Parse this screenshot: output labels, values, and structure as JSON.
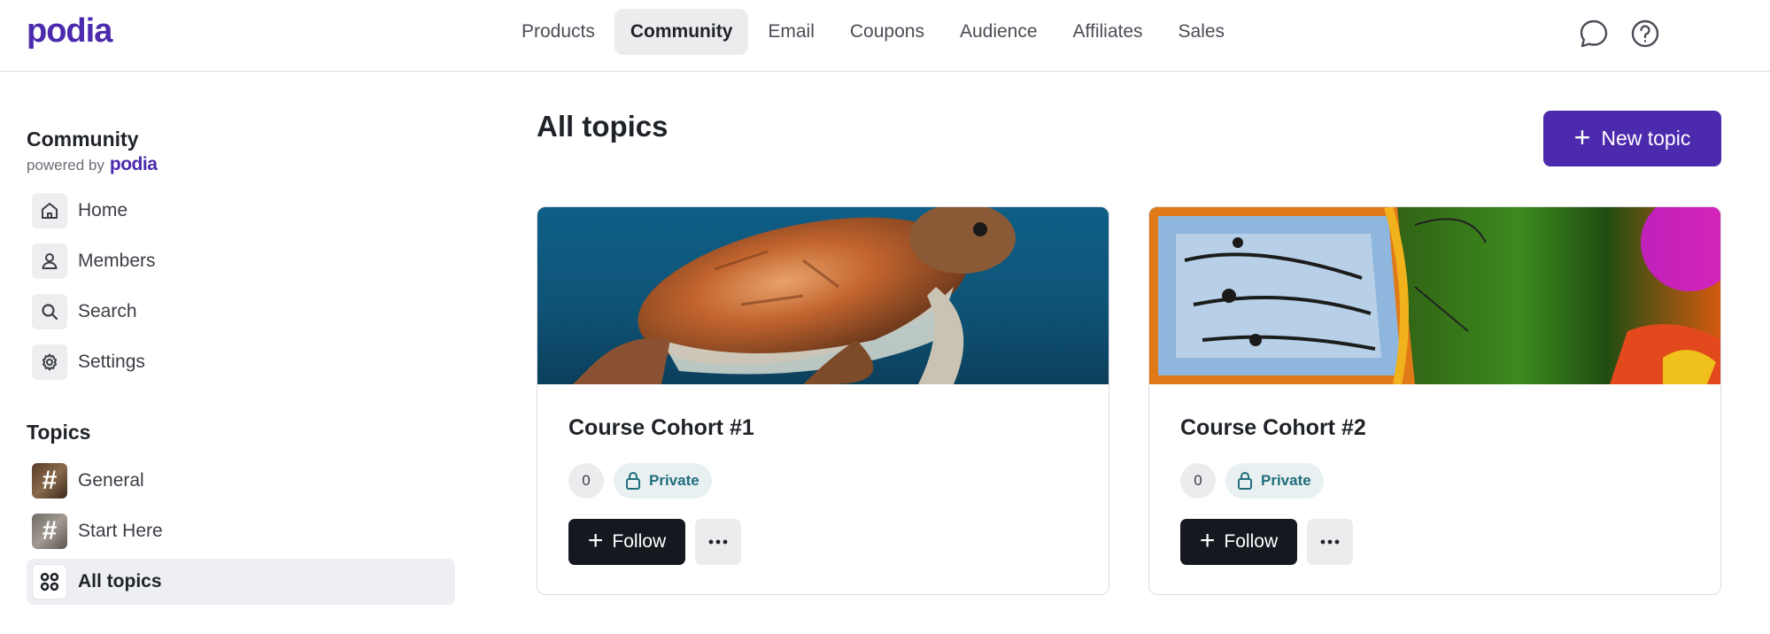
{
  "app": {
    "logo": "podia"
  },
  "nav": {
    "items": [
      {
        "label": "Products",
        "active": false
      },
      {
        "label": "Community",
        "active": true
      },
      {
        "label": "Email",
        "active": false
      },
      {
        "label": "Coupons",
        "active": false
      },
      {
        "label": "Audience",
        "active": false
      },
      {
        "label": "Affiliates",
        "active": false
      },
      {
        "label": "Sales",
        "active": false
      }
    ],
    "icons": [
      "chat-bubble-icon",
      "help-circle-icon"
    ]
  },
  "sidebar": {
    "title": "Community",
    "powered_by": "powered by",
    "powered_logo": "podia",
    "items": [
      {
        "label": "Home",
        "icon": "home-icon"
      },
      {
        "label": "Members",
        "icon": "user-icon"
      },
      {
        "label": "Search",
        "icon": "search-icon"
      },
      {
        "label": "Settings",
        "icon": "gear-icon"
      }
    ],
    "topics_title": "Topics",
    "topics": [
      {
        "label": "General",
        "icon": "hash-icon"
      },
      {
        "label": "Start Here",
        "icon": "hash-icon"
      },
      {
        "label": "All topics",
        "icon": "grid-icon",
        "active": true
      }
    ]
  },
  "main": {
    "title": "All topics",
    "new_topic_label": "New topic",
    "cards": [
      {
        "title": "Course Cohort #1",
        "count": "0",
        "privacy": "Private",
        "follow_label": "Follow",
        "image": "sea-turtle"
      },
      {
        "title": "Course Cohort #2",
        "count": "0",
        "privacy": "Private",
        "follow_label": "Follow",
        "image": "butterfly"
      }
    ]
  },
  "colors": {
    "brand": "#4b2aad",
    "dark_button": "#15191f",
    "private_text": "#1f6e7a"
  }
}
